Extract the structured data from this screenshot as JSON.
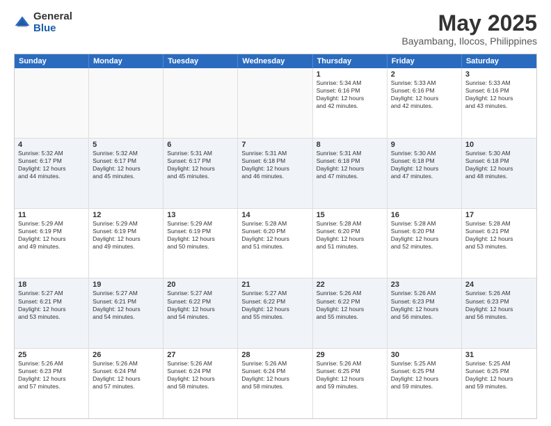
{
  "logo": {
    "general": "General",
    "blue": "Blue"
  },
  "title": "May 2025",
  "subtitle": "Bayambang, Ilocos, Philippines",
  "header_days": [
    "Sunday",
    "Monday",
    "Tuesday",
    "Wednesday",
    "Thursday",
    "Friday",
    "Saturday"
  ],
  "weeks": [
    [
      {
        "day": "",
        "info": ""
      },
      {
        "day": "",
        "info": ""
      },
      {
        "day": "",
        "info": ""
      },
      {
        "day": "",
        "info": ""
      },
      {
        "day": "1",
        "info": "Sunrise: 5:34 AM\nSunset: 6:16 PM\nDaylight: 12 hours\nand 42 minutes."
      },
      {
        "day": "2",
        "info": "Sunrise: 5:33 AM\nSunset: 6:16 PM\nDaylight: 12 hours\nand 42 minutes."
      },
      {
        "day": "3",
        "info": "Sunrise: 5:33 AM\nSunset: 6:16 PM\nDaylight: 12 hours\nand 43 minutes."
      }
    ],
    [
      {
        "day": "4",
        "info": "Sunrise: 5:32 AM\nSunset: 6:17 PM\nDaylight: 12 hours\nand 44 minutes."
      },
      {
        "day": "5",
        "info": "Sunrise: 5:32 AM\nSunset: 6:17 PM\nDaylight: 12 hours\nand 45 minutes."
      },
      {
        "day": "6",
        "info": "Sunrise: 5:31 AM\nSunset: 6:17 PM\nDaylight: 12 hours\nand 45 minutes."
      },
      {
        "day": "7",
        "info": "Sunrise: 5:31 AM\nSunset: 6:18 PM\nDaylight: 12 hours\nand 46 minutes."
      },
      {
        "day": "8",
        "info": "Sunrise: 5:31 AM\nSunset: 6:18 PM\nDaylight: 12 hours\nand 47 minutes."
      },
      {
        "day": "9",
        "info": "Sunrise: 5:30 AM\nSunset: 6:18 PM\nDaylight: 12 hours\nand 47 minutes."
      },
      {
        "day": "10",
        "info": "Sunrise: 5:30 AM\nSunset: 6:18 PM\nDaylight: 12 hours\nand 48 minutes."
      }
    ],
    [
      {
        "day": "11",
        "info": "Sunrise: 5:29 AM\nSunset: 6:19 PM\nDaylight: 12 hours\nand 49 minutes."
      },
      {
        "day": "12",
        "info": "Sunrise: 5:29 AM\nSunset: 6:19 PM\nDaylight: 12 hours\nand 49 minutes."
      },
      {
        "day": "13",
        "info": "Sunrise: 5:29 AM\nSunset: 6:19 PM\nDaylight: 12 hours\nand 50 minutes."
      },
      {
        "day": "14",
        "info": "Sunrise: 5:28 AM\nSunset: 6:20 PM\nDaylight: 12 hours\nand 51 minutes."
      },
      {
        "day": "15",
        "info": "Sunrise: 5:28 AM\nSunset: 6:20 PM\nDaylight: 12 hours\nand 51 minutes."
      },
      {
        "day": "16",
        "info": "Sunrise: 5:28 AM\nSunset: 6:20 PM\nDaylight: 12 hours\nand 52 minutes."
      },
      {
        "day": "17",
        "info": "Sunrise: 5:28 AM\nSunset: 6:21 PM\nDaylight: 12 hours\nand 53 minutes."
      }
    ],
    [
      {
        "day": "18",
        "info": "Sunrise: 5:27 AM\nSunset: 6:21 PM\nDaylight: 12 hours\nand 53 minutes."
      },
      {
        "day": "19",
        "info": "Sunrise: 5:27 AM\nSunset: 6:21 PM\nDaylight: 12 hours\nand 54 minutes."
      },
      {
        "day": "20",
        "info": "Sunrise: 5:27 AM\nSunset: 6:22 PM\nDaylight: 12 hours\nand 54 minutes."
      },
      {
        "day": "21",
        "info": "Sunrise: 5:27 AM\nSunset: 6:22 PM\nDaylight: 12 hours\nand 55 minutes."
      },
      {
        "day": "22",
        "info": "Sunrise: 5:26 AM\nSunset: 6:22 PM\nDaylight: 12 hours\nand 55 minutes."
      },
      {
        "day": "23",
        "info": "Sunrise: 5:26 AM\nSunset: 6:23 PM\nDaylight: 12 hours\nand 56 minutes."
      },
      {
        "day": "24",
        "info": "Sunrise: 5:26 AM\nSunset: 6:23 PM\nDaylight: 12 hours\nand 56 minutes."
      }
    ],
    [
      {
        "day": "25",
        "info": "Sunrise: 5:26 AM\nSunset: 6:23 PM\nDaylight: 12 hours\nand 57 minutes."
      },
      {
        "day": "26",
        "info": "Sunrise: 5:26 AM\nSunset: 6:24 PM\nDaylight: 12 hours\nand 57 minutes."
      },
      {
        "day": "27",
        "info": "Sunrise: 5:26 AM\nSunset: 6:24 PM\nDaylight: 12 hours\nand 58 minutes."
      },
      {
        "day": "28",
        "info": "Sunrise: 5:26 AM\nSunset: 6:24 PM\nDaylight: 12 hours\nand 58 minutes."
      },
      {
        "day": "29",
        "info": "Sunrise: 5:26 AM\nSunset: 6:25 PM\nDaylight: 12 hours\nand 59 minutes."
      },
      {
        "day": "30",
        "info": "Sunrise: 5:25 AM\nSunset: 6:25 PM\nDaylight: 12 hours\nand 59 minutes."
      },
      {
        "day": "31",
        "info": "Sunrise: 5:25 AM\nSunset: 6:25 PM\nDaylight: 12 hours\nand 59 minutes."
      }
    ]
  ]
}
